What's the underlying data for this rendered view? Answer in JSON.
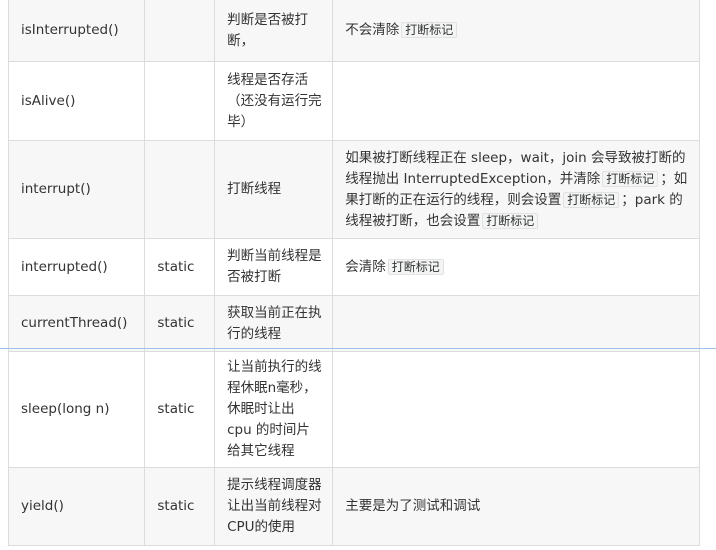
{
  "rows": [
    {
      "method": "isInterrupted()",
      "static": "",
      "desc": "判断是否被打断，",
      "note": [
        {
          "t": "text",
          "v": "不会清除"
        },
        {
          "t": "code",
          "v": "打断标记"
        }
      ]
    },
    {
      "method": "isAlive()",
      "static": "",
      "desc": "线程是否存活（还没有运行完毕）",
      "note": []
    },
    {
      "method": "interrupt()",
      "static": "",
      "desc": "打断线程",
      "note": [
        {
          "t": "text",
          "v": "如果被打断线程正在 sleep，wait，join 会导致被打断的线程抛出 InterruptedException，并清除"
        },
        {
          "t": "code",
          "v": "打断标记"
        },
        {
          "t": "text",
          "v": "；如果打断的正在运行的线程，则会设置"
        },
        {
          "t": "code",
          "v": "打断标记"
        },
        {
          "t": "text",
          "v": "；park 的线程被打断，也会设置"
        },
        {
          "t": "code",
          "v": "打断标记"
        }
      ]
    },
    {
      "method": "interrupted()",
      "static": "static",
      "desc": "判断当前线程是否被打断",
      "note": [
        {
          "t": "text",
          "v": "会清除"
        },
        {
          "t": "code",
          "v": "打断标记"
        }
      ]
    },
    {
      "method": "currentThread()",
      "static": "static",
      "desc": "获取当前正在执行的线程",
      "note": []
    },
    {
      "method": "sleep(long n)",
      "static": "static",
      "desc": "让当前执行的线程休眠n毫秒，休眠时让出 cpu 的时间片给其它线程",
      "note": []
    },
    {
      "method": "yield()",
      "static": "static",
      "desc": "提示线程调度器让出当前线程对CPU的使用",
      "note": [
        {
          "t": "text",
          "v": "主要是为了测试和调试"
        }
      ]
    }
  ]
}
